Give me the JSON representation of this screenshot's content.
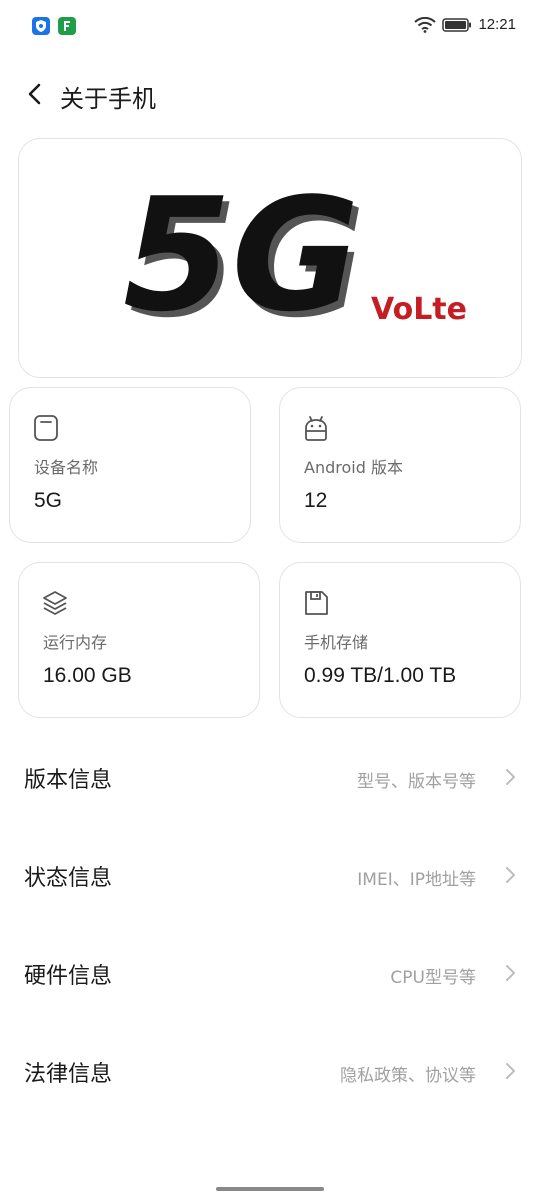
{
  "status_bar": {
    "time": "12:21",
    "icons": [
      "shield-app-icon",
      "green-app-icon",
      "wifi-icon",
      "battery-icon"
    ]
  },
  "header": {
    "title": "关于手机",
    "back_icon": "chevron-left-icon"
  },
  "hero": {
    "logo_text": "5G",
    "volte_text": "VoLte"
  },
  "cards": {
    "device_name": {
      "label": "设备名称",
      "value": "5G",
      "icon": "square-icon"
    },
    "android_version": {
      "label": "Android 版本",
      "value": "12",
      "icon": "android-icon"
    },
    "ram": {
      "label": "运行内存",
      "value": "16.00 GB",
      "icon": "layers-icon"
    },
    "storage": {
      "label": "手机存储",
      "value": "0.99 TB/1.00 TB",
      "icon": "sd-card-icon"
    }
  },
  "list": [
    {
      "title": "版本信息",
      "subtitle": "型号、版本号等"
    },
    {
      "title": "状态信息",
      "subtitle": "IMEI、IP地址等"
    },
    {
      "title": "硬件信息",
      "subtitle": "CPU型号等"
    },
    {
      "title": "法律信息",
      "subtitle": "隐私政策、协议等"
    }
  ],
  "colors": {
    "accent_red": "#c41e24",
    "text_primary": "#1a1a1a",
    "text_secondary": "#a0a0a0",
    "card_border": "#e3e3e3"
  }
}
